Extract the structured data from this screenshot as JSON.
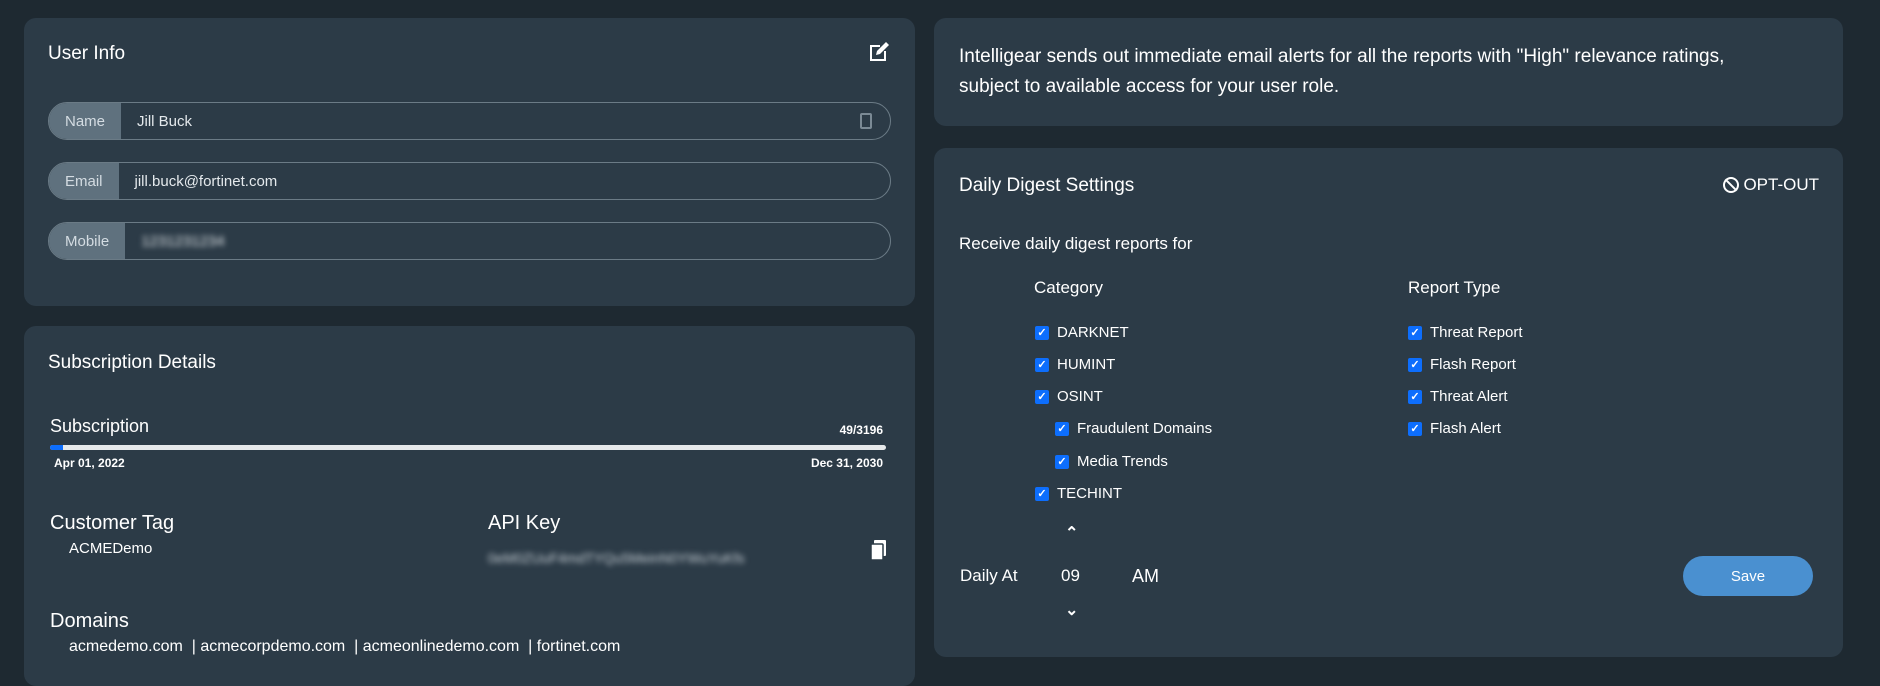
{
  "user_info": {
    "title": "User Info",
    "fields": [
      {
        "label": "Name",
        "value": "Jill Buck"
      },
      {
        "label": "Email",
        "value": "jill.buck@fortinet.com"
      },
      {
        "label": "Mobile",
        "value": "1231231234"
      }
    ]
  },
  "subscription": {
    "title": "Subscription Details",
    "label": "Subscription",
    "count": "49/3196",
    "progress": 0.0153,
    "start": "Apr 01, 2022",
    "end": "Dec 31, 2030",
    "customer_tag_label": "Customer Tag",
    "customer_tag": "ACMEDemo",
    "api_key_label": "API Key",
    "api_key": "0eM0ZUuF4mdTYQu5MeinN0YWuYuKfs",
    "domains_label": "Domains",
    "domains": "acmedemo.com  | acmecorpdemo.com  | acmeonlinedemo.com  | fortinet.com"
  },
  "notice": {
    "text": "Intelligear sends out immediate email alerts for all the reports with \"High\" relevance ratings, subject to available access for your user role."
  },
  "digest": {
    "title": "Daily Digest Settings",
    "opt_out": "OPT-OUT",
    "receive": "Receive daily digest reports for",
    "category_label": "Category",
    "report_type_label": "Report Type",
    "categories": [
      {
        "label": "DARKNET",
        "checked": true
      },
      {
        "label": "HUMINT",
        "checked": true
      },
      {
        "label": "OSINT",
        "checked": true
      },
      {
        "label": "Fraudulent Domains",
        "checked": true
      },
      {
        "label": "Media Trends",
        "checked": true
      },
      {
        "label": "TECHINT",
        "checked": true
      }
    ],
    "report_types": [
      {
        "label": "Threat Report",
        "checked": true
      },
      {
        "label": "Flash Report",
        "checked": true
      },
      {
        "label": "Threat Alert",
        "checked": true
      },
      {
        "label": "Flash Alert",
        "checked": true
      }
    ],
    "daily_at_label": "Daily At",
    "hour": "09",
    "ampm": "AM",
    "save": "Save",
    "check_glyph": "✓"
  },
  "colors": {
    "accent": "#0d6efd",
    "save": "#4a90d0"
  }
}
